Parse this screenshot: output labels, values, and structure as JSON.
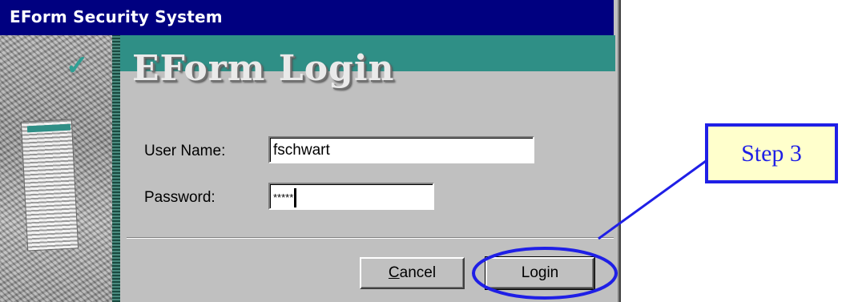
{
  "window": {
    "title": "EForm Security System"
  },
  "banner": {
    "title": "EForm Login"
  },
  "form": {
    "username_label": "User Name:",
    "username_value": "fschwart",
    "password_label": "Password:",
    "password_mask": "*****"
  },
  "buttons": {
    "cancel_mnemonic": "C",
    "cancel_rest": "ancel",
    "login_label": "Login"
  },
  "annotation": {
    "step_label": "Step 3",
    "color": "#1f1fe6",
    "box_fill": "#ffffcc"
  },
  "colors": {
    "titlebar": "#000080",
    "banner": "#2f8f86",
    "dialog_bg": "#c0c0c0"
  }
}
